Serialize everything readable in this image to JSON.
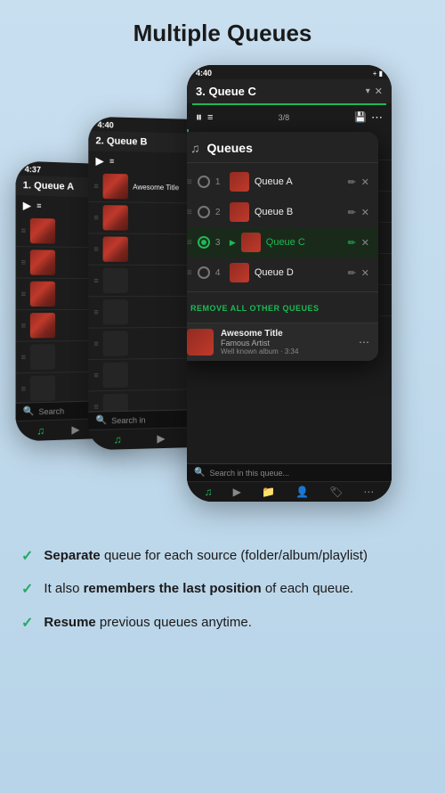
{
  "page": {
    "title": "Multiple Queues",
    "bg_color": "#c8dff0"
  },
  "phones": {
    "phone1": {
      "time": "4:37",
      "queue_name": "1. Queue A"
    },
    "phone2": {
      "time": "4:40",
      "queue_name": "2. Queue B"
    },
    "phone3": {
      "time": "4:40",
      "queue_name": "3. Queue C",
      "track_count": "3/8"
    }
  },
  "queues_popup": {
    "title": "Queues",
    "items": [
      {
        "num": "1",
        "name": "Queue A",
        "selected": false
      },
      {
        "num": "2",
        "name": "Queue B",
        "selected": false
      },
      {
        "num": "3",
        "name": "Queue C",
        "selected": true,
        "playing": true
      },
      {
        "num": "4",
        "name": "Queue D",
        "selected": false
      }
    ],
    "remove_btn": "REMOVE ALL OTHER QUEUES"
  },
  "now_playing": {
    "title": "Awesome Title",
    "artist": "Famous Artist",
    "time": "Well known album · 3:34"
  },
  "search": {
    "placeholder": "Search in this queue..."
  },
  "features": [
    {
      "bold_part": "Separate",
      "rest": " queue for each source (folder/album/playlist)"
    },
    {
      "bold_part": "",
      "pre": "It also ",
      "bold_mid": "remembers the last position",
      "rest": " of each queue."
    },
    {
      "bold_part": "Resume",
      "rest": " previous queues anytime."
    }
  ]
}
